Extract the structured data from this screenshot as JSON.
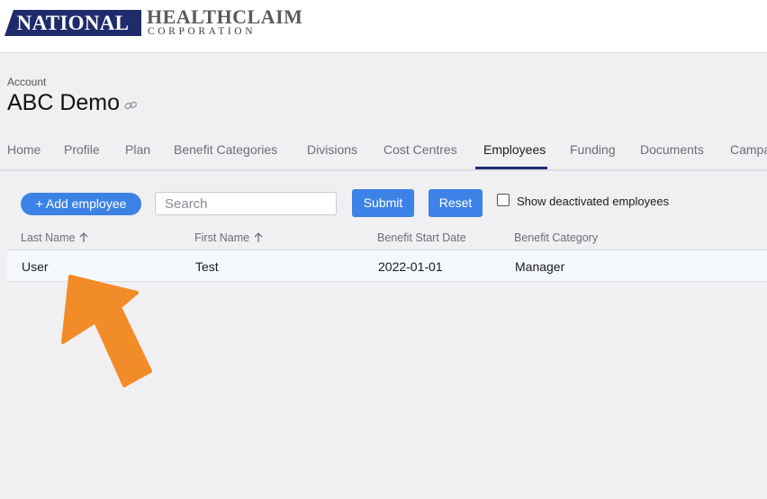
{
  "brand": {
    "national": "NATIONAL",
    "healthclaim": "HEALTHCLAIM",
    "corporation": "CORPORATION",
    "navy": "#1f2b6b"
  },
  "account": {
    "label": "Account",
    "title": "ABC Demo",
    "link_icon": "link-icon"
  },
  "tabs": [
    {
      "label": "Home"
    },
    {
      "label": "Profile"
    },
    {
      "label": "Plan"
    },
    {
      "label": "Benefit Categories"
    },
    {
      "label": "Divisions"
    },
    {
      "label": "Cost Centres"
    },
    {
      "label": "Employees",
      "active": true
    },
    {
      "label": "Funding"
    },
    {
      "label": "Documents"
    },
    {
      "label": "Campa"
    }
  ],
  "toolbar": {
    "add_label": "+ Add employee",
    "search_placeholder": "Search",
    "submit_label": "Submit",
    "reset_label": "Reset",
    "show_deactivated_label": "Show deactivated employees",
    "show_deactivated_checked": false
  },
  "table": {
    "columns": [
      "Last Name",
      "First Name",
      "Benefit Start Date",
      "Benefit Category"
    ],
    "sort_icon": "arrow-up-icon",
    "rows": [
      {
        "last_name": "User",
        "first_name": "Test",
        "start_date": "2022-01-01",
        "category": "Manager"
      }
    ]
  },
  "annotation": {
    "icon": "pointer-arrow-icon",
    "color": "#f28c28"
  }
}
